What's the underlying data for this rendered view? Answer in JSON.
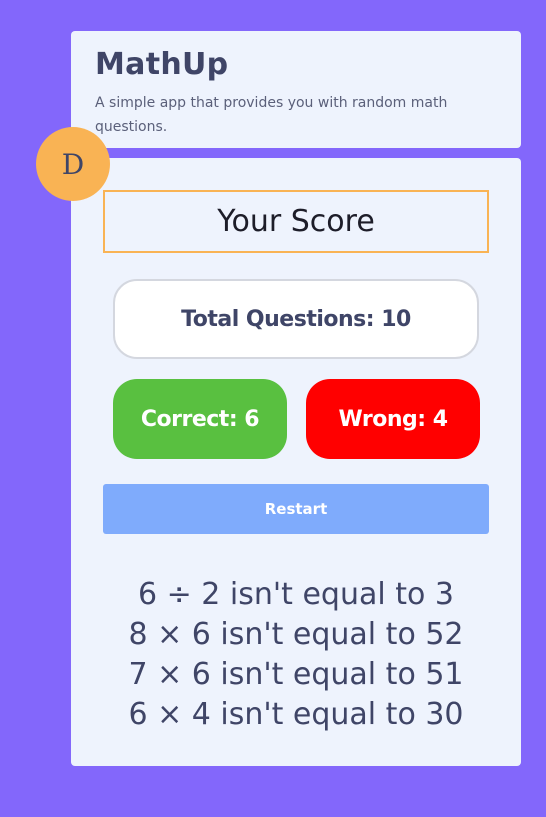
{
  "app": {
    "title": "MathUp",
    "subtitle": "A simple app that provides you with random math questions."
  },
  "avatar": {
    "initial": "D"
  },
  "score": {
    "heading": "Your Score",
    "total_label": "Total Questions: 10",
    "correct_label": "Correct: 6",
    "wrong_label": "Wrong: 4"
  },
  "actions": {
    "restart_label": "Restart"
  },
  "mistakes": [
    "6 ÷ 2 isn't equal to 3",
    "8 × 6 isn't equal to 52",
    "7 × 6 isn't equal to 51",
    "6 × 4 isn't equal to 30"
  ],
  "colors": {
    "background": "#8367fb",
    "card": "#eef3fd",
    "accent_orange": "#f9b354",
    "correct_green": "#59c040",
    "wrong_red": "#ff0000",
    "restart_blue": "#7fabfc",
    "text_dark": "#3f4567"
  }
}
